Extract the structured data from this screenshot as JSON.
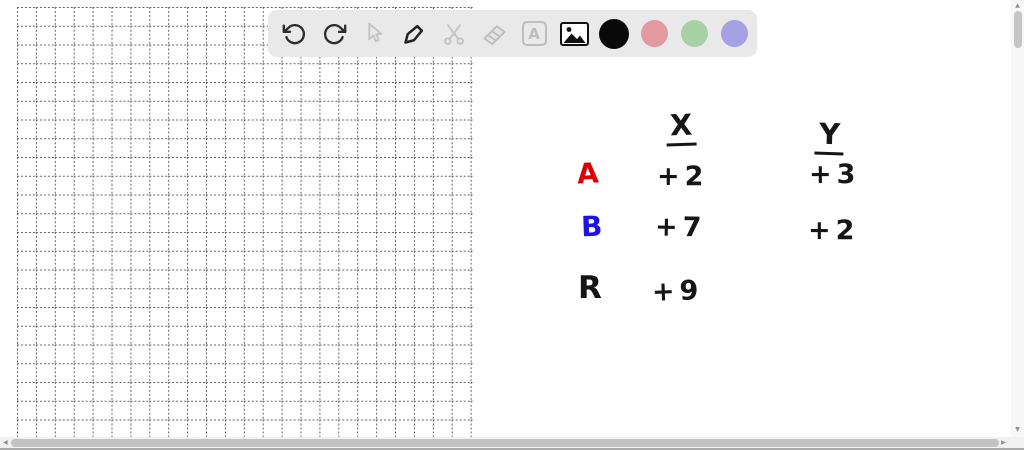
{
  "toolbar": {
    "background": "#e9e9e9",
    "tools": [
      {
        "icon": "undo-icon",
        "enabled": true
      },
      {
        "icon": "redo-icon",
        "enabled": true
      },
      {
        "icon": "pointer-icon",
        "enabled": false
      },
      {
        "icon": "pen-icon",
        "enabled": true
      },
      {
        "icon": "scissors-icon",
        "enabled": false
      },
      {
        "icon": "eraser-icon",
        "enabled": false
      },
      {
        "icon": "text-icon",
        "enabled": false
      },
      {
        "icon": "image-icon",
        "enabled": true
      }
    ],
    "text_tool_glyph": "A",
    "colors": [
      {
        "id": "black",
        "hex": "#0a0a0a",
        "selected": true
      },
      {
        "id": "red",
        "hex": "#e29aa0",
        "selected": false
      },
      {
        "id": "green",
        "hex": "#a8d0a5",
        "selected": false
      },
      {
        "id": "purple",
        "hex": "#a6a1e4",
        "selected": false
      }
    ]
  },
  "whiteboard": {
    "ink_colors": {
      "black": "#161616",
      "red": "#e00008",
      "blue": "#2012e6"
    },
    "table": {
      "columns": [
        "X",
        "Y"
      ],
      "rows": [
        {
          "label": "A",
          "color": "red",
          "X": "+2",
          "Y": "+3"
        },
        {
          "label": "B",
          "color": "blue",
          "X": "+7",
          "Y": "+2"
        },
        {
          "label": "R",
          "color": "black",
          "X": "+9",
          "Y": ""
        }
      ]
    }
  }
}
